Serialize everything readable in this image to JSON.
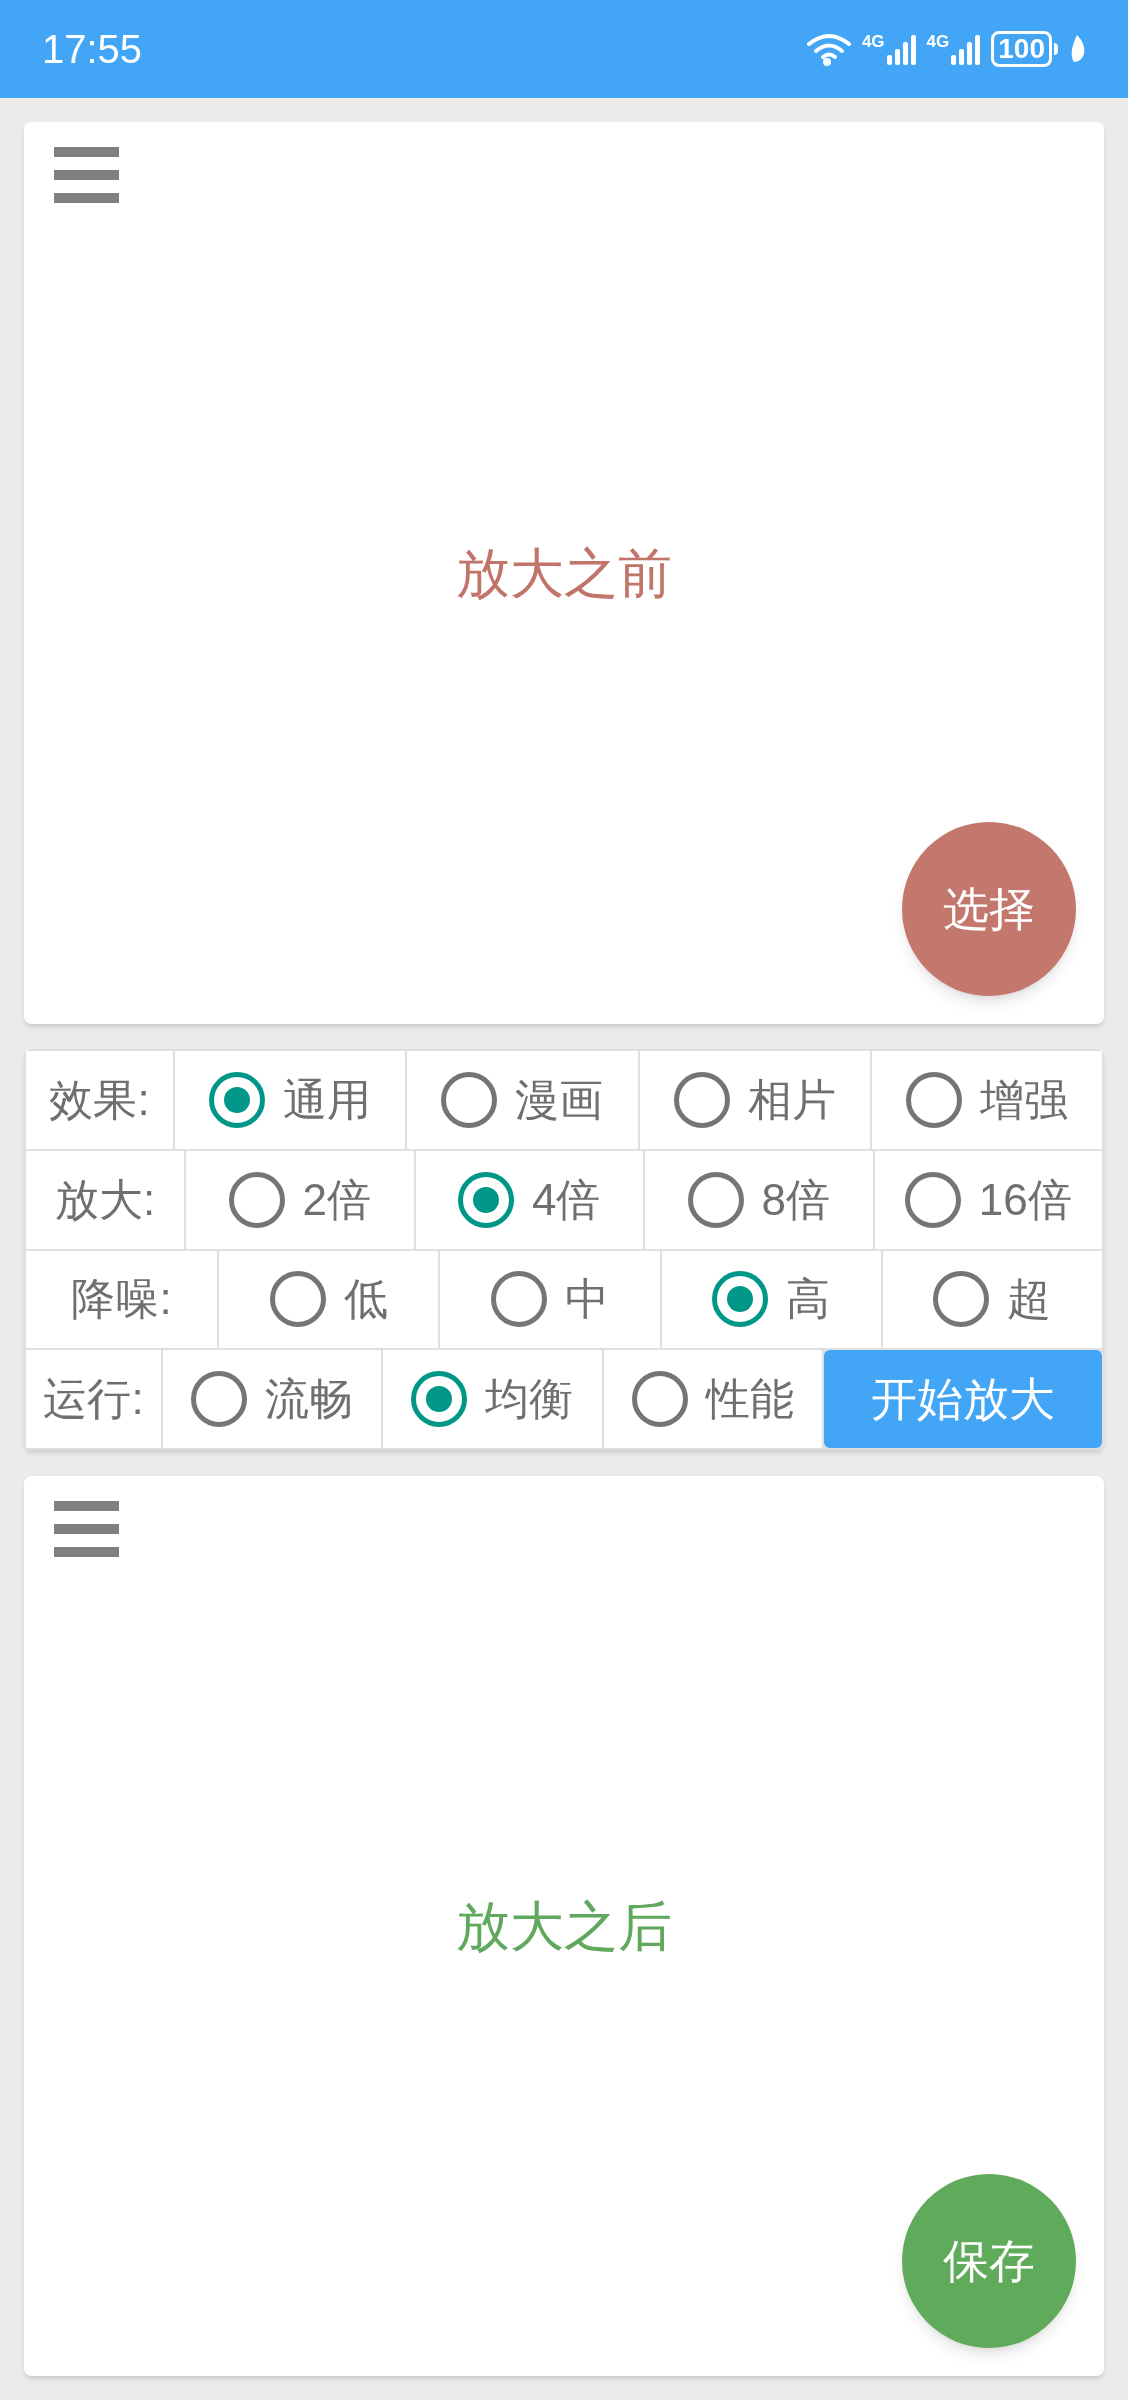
{
  "status_bar": {
    "time": "17:55",
    "network_labels": [
      "4G",
      "4G"
    ],
    "battery": "100"
  },
  "input_panel": {
    "placeholder_text": "放大之前",
    "button": "选择"
  },
  "options": [
    {
      "label": "效果:",
      "choices": [
        {
          "label": "通用",
          "selected": true
        },
        {
          "label": "漫画",
          "selected": false
        },
        {
          "label": "相片",
          "selected": false
        },
        {
          "label": "增强",
          "selected": false
        }
      ]
    },
    {
      "label": "放大:",
      "choices": [
        {
          "label": "2倍",
          "selected": false
        },
        {
          "label": "4倍",
          "selected": true
        },
        {
          "label": "8倍",
          "selected": false
        },
        {
          "label": "16倍",
          "selected": false
        }
      ]
    },
    {
      "label": "降噪:",
      "choices": [
        {
          "label": "低",
          "selected": false
        },
        {
          "label": "中",
          "selected": false
        },
        {
          "label": "高",
          "selected": true
        },
        {
          "label": "超",
          "selected": false
        }
      ]
    },
    {
      "label": "运行:",
      "choices": [
        {
          "label": "流畅",
          "selected": false
        },
        {
          "label": "均衡",
          "selected": true
        },
        {
          "label": "性能",
          "selected": false
        }
      ]
    }
  ],
  "start_button": "开始放大",
  "output_panel": {
    "placeholder_text": "放大之后",
    "button": "保存"
  }
}
